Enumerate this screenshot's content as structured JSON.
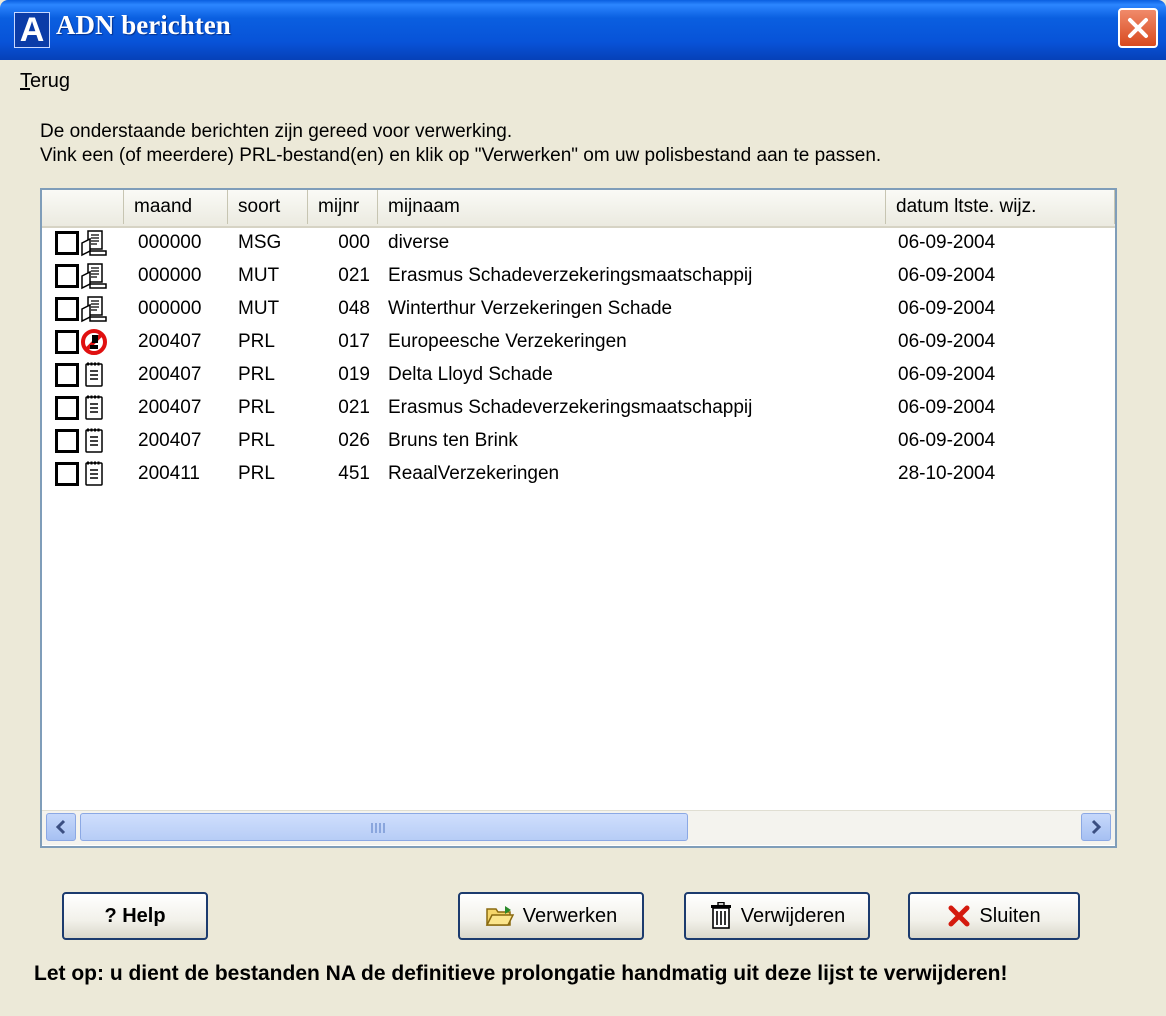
{
  "window": {
    "title": "ADN berichten",
    "app_icon_letter": "A"
  },
  "menu": {
    "terug_ul": "T",
    "terug_rest": "erug"
  },
  "description": {
    "line1": "De onderstaande berichten zijn gereed voor verwerking.",
    "line2": "Vink een (of meerdere) PRL-bestand(en) en klik op \"Verwerken\" om uw polisbestand aan te passen."
  },
  "columns": [
    "",
    "maand",
    "soort",
    "mijnr",
    "mijnaam",
    "datum ltste. wijz."
  ],
  "rows": [
    {
      "icon": "message-doc-icon",
      "maand": "000000",
      "soort": "MSG",
      "mijnr": "000",
      "mijnaam": "diverse",
      "datum": "06-09-2004"
    },
    {
      "icon": "message-doc-icon",
      "maand": "000000",
      "soort": "MUT",
      "mijnr": "021",
      "mijnaam": "Erasmus Schadeverzekeringsmaatschappij",
      "datum": "06-09-2004"
    },
    {
      "icon": "message-doc-icon",
      "maand": "000000",
      "soort": "MUT",
      "mijnr": "048",
      "mijnaam": "Winterthur Verzekeringen Schade",
      "datum": "06-09-2004"
    },
    {
      "icon": "blocked-icon",
      "maand": "200407",
      "soort": "PRL",
      "mijnr": "017",
      "mijnaam": "Europeesche Verzekeringen",
      "datum": "06-09-2004"
    },
    {
      "icon": "notepad-icon",
      "maand": "200407",
      "soort": "PRL",
      "mijnr": "019",
      "mijnaam": "Delta Lloyd Schade",
      "datum": "06-09-2004"
    },
    {
      "icon": "notepad-icon",
      "maand": "200407",
      "soort": "PRL",
      "mijnr": "021",
      "mijnaam": "Erasmus Schadeverzekeringsmaatschappij",
      "datum": "06-09-2004"
    },
    {
      "icon": "notepad-icon",
      "maand": "200407",
      "soort": "PRL",
      "mijnr": "026",
      "mijnaam": "Bruns ten Brink",
      "datum": "06-09-2004"
    },
    {
      "icon": "notepad-icon",
      "maand": "200411",
      "soort": "PRL",
      "mijnr": "451",
      "mijnaam": "ReaalVerzekeringen",
      "datum": "28-10-2004"
    }
  ],
  "buttons": {
    "help": "? Help",
    "verwerken": "Verwerken",
    "verwijderen": "Verwijderen",
    "sluiten": "Sluiten"
  },
  "footer_note": "Let op: u dient de bestanden NA de definitieve prolongatie handmatig uit deze lijst te verwijderen!",
  "colors": {
    "titlebar": "#0a5fe0",
    "face": "#ece9d8",
    "list_border": "#7f9db9"
  }
}
